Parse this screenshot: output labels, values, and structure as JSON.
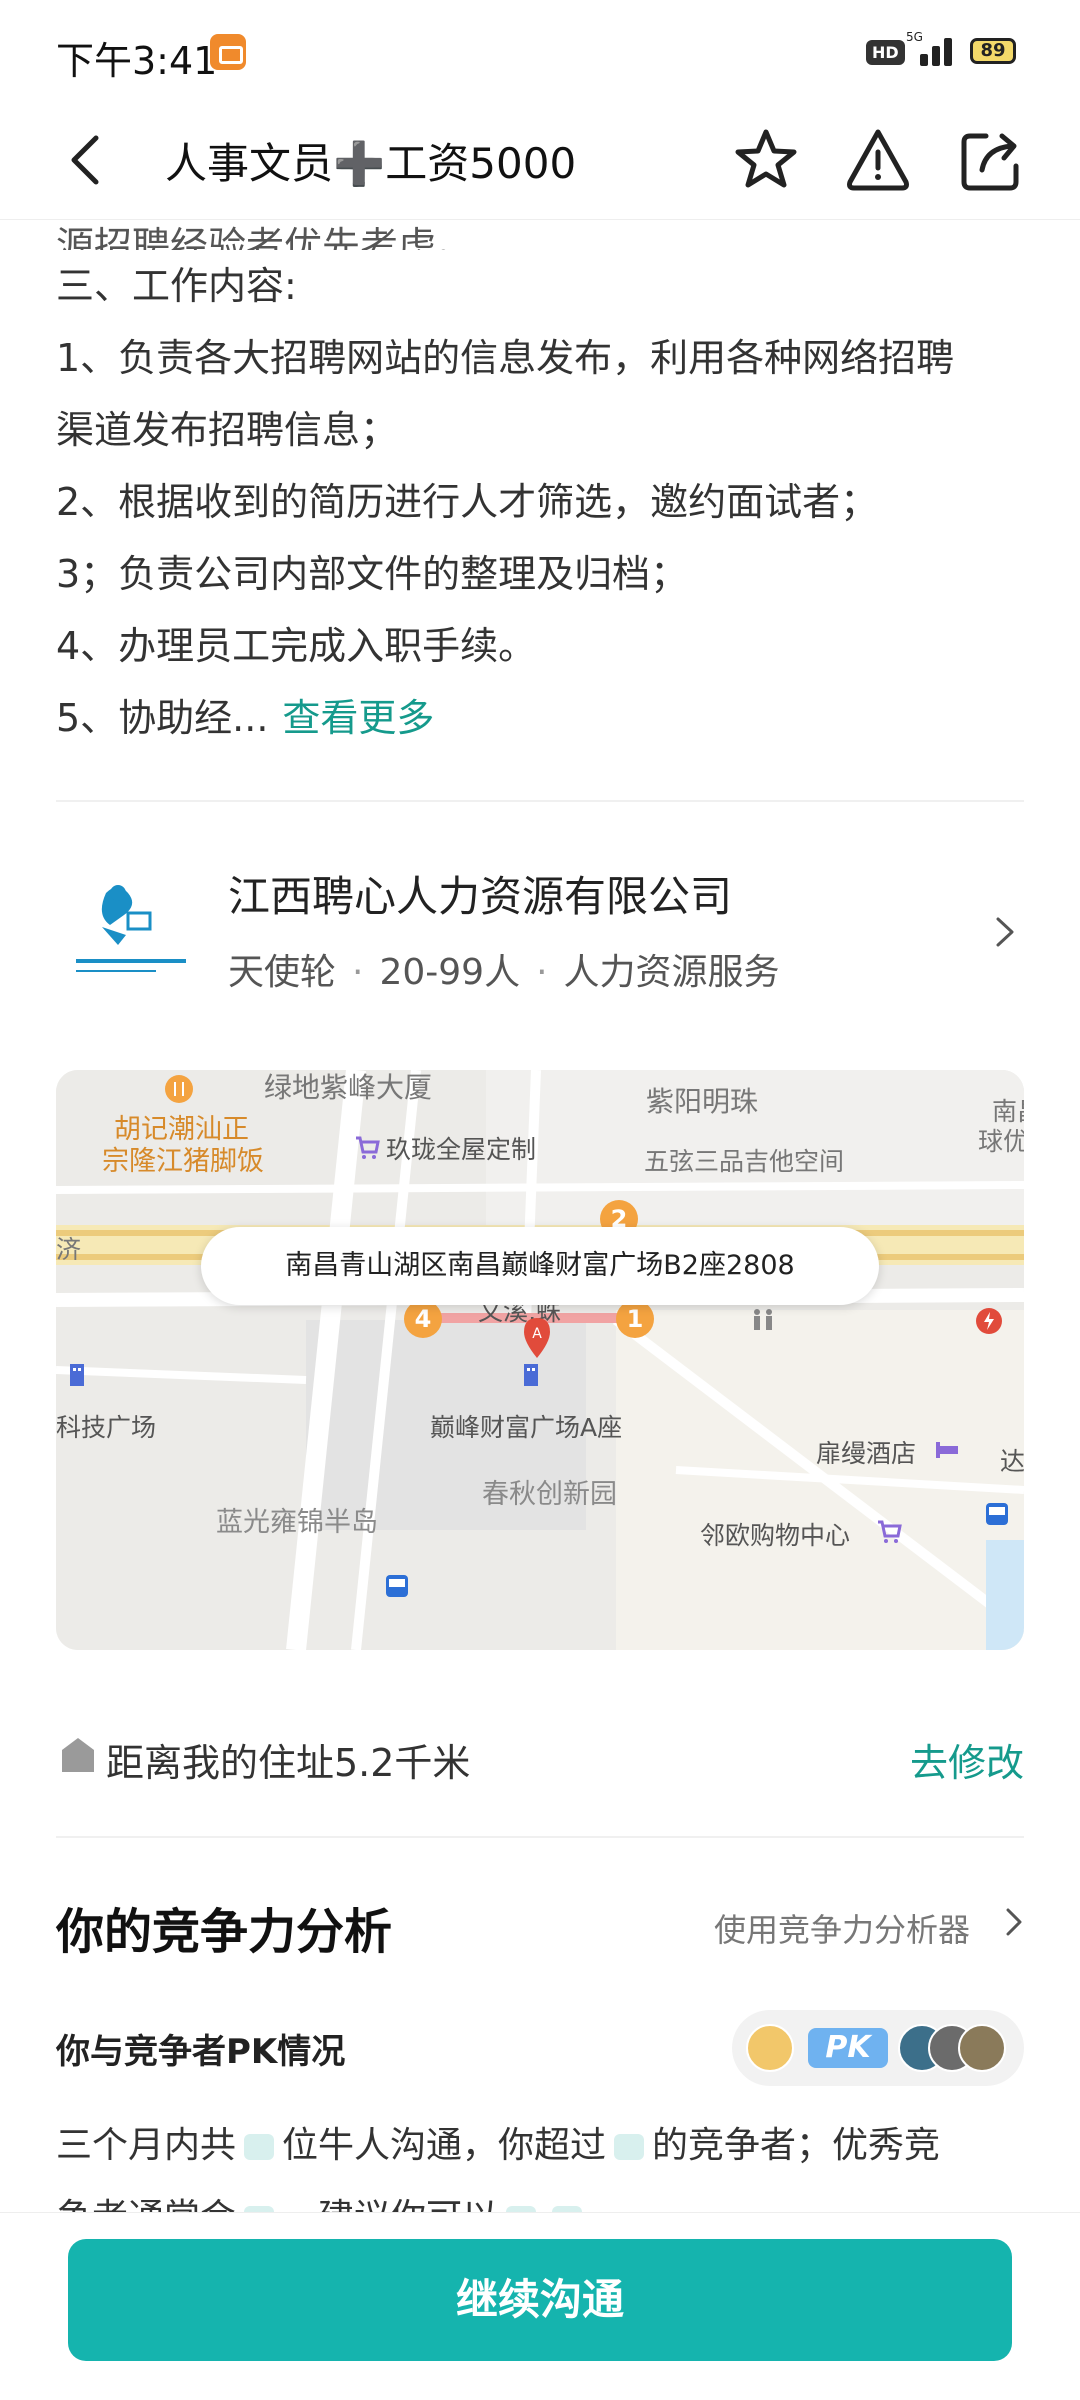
{
  "status_bar": {
    "time": "下午3:41",
    "hd": "HD",
    "network": "5G",
    "battery": "89"
  },
  "nav": {
    "title": "人事文员➕工资5000"
  },
  "description": {
    "cut_line": "源招聘经验者优先考虑。",
    "lines": [
      "三、工作内容:",
      "1、负责各大招聘网站的信息发布，利用各种网络招聘",
      "渠道发布招聘信息；",
      "2、根据收到的简历进行人才筛选，邀约面试者；",
      "3；负责公司内部文件的整理及归档；",
      "4、办理员工完成入职手续。",
      "5、协助经..."
    ],
    "see_more": "查看更多"
  },
  "company": {
    "name": "江西聘心人力资源有限公司",
    "funding": "天使轮",
    "size": "20-99人",
    "industry": "人力资源服务"
  },
  "map": {
    "address": "南昌青山湖区南昌巅峰财富广场B2座2808",
    "labels": {
      "l1": "绿地紫峰大厦",
      "l2": "紫阳明珠",
      "l3": "南昌",
      "l4": "球优",
      "l5": "胡记潮汕正",
      "l6": "宗隆江猪脚饭",
      "l7": "玖珑全屋定制",
      "l8": "五弦三品吉他空间",
      "l9": "济",
      "l10": "文溪,蛛",
      "l11": "科技广场",
      "l12": "巅峰财富广场A座",
      "l13": "春秋创新园",
      "l14": "扉缦酒店",
      "l15": "达",
      "l16": "蓝光雍锦半岛",
      "l17": "邻欧购物中心"
    },
    "badges": [
      "1",
      "2",
      "4"
    ]
  },
  "distance": {
    "text": "距离我的住址5.2千米",
    "edit": "去修改"
  },
  "competition": {
    "title": "你的竞争力分析",
    "tool": "使用竞争力分析器",
    "pk_title": "你与竞争者PK情况",
    "pk_badge": "PK",
    "text1": "三个月内共",
    "text2": "位牛人沟通，你超过",
    "text3": "的竞争者；优秀竞",
    "text4": "争者通常会",
    "text5": "，建议你可以"
  },
  "bottom": {
    "continue": "继续沟通"
  }
}
